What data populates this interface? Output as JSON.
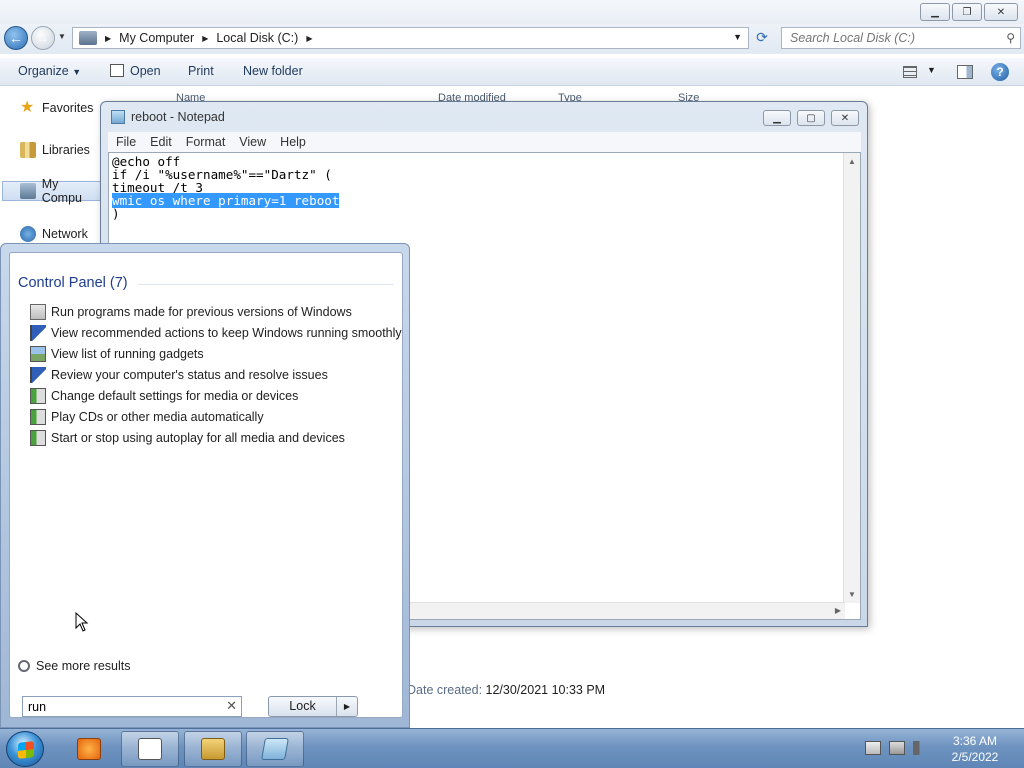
{
  "explorer": {
    "address": {
      "crumbs": [
        "My Computer",
        "Local Disk (C:)"
      ]
    },
    "search": {
      "placeholder": "Search Local Disk (C:)"
    },
    "toolbar": {
      "organize": "Organize",
      "open": "Open",
      "print": "Print",
      "new_folder": "New folder"
    },
    "nav": {
      "items": [
        "Favorites",
        "Libraries",
        "My Compu",
        "Network"
      ]
    },
    "columns": [
      "Name",
      "Date modified",
      "Type",
      "Size"
    ],
    "details": {
      "label": "Date created:",
      "value": "12/30/2021 10:33 PM"
    }
  },
  "notepad": {
    "title": "reboot - Notepad",
    "menu": [
      "File",
      "Edit",
      "Format",
      "View",
      "Help"
    ],
    "lines": [
      "@echo off",
      "if /i \"%username%\"==\"Dartz\" (",
      "timeout /t 3",
      "wmic os where primary=1 reboot",
      ")"
    ],
    "selected_line_index": 3
  },
  "startmenu": {
    "group_header": "Control Panel (7)",
    "results": [
      {
        "label": "Run programs made for previous versions of Windows",
        "icon": "compatibility-icon"
      },
      {
        "label": "View recommended actions to keep Windows running smoothly",
        "icon": "action-center-flag-icon"
      },
      {
        "label": "View list of running gadgets",
        "icon": "gadgets-icon"
      },
      {
        "label": "Review your computer's status and resolve issues",
        "icon": "action-center-flag-icon"
      },
      {
        "label": "Change default settings for media or devices",
        "icon": "autoplay-icon"
      },
      {
        "label": "Play CDs or other media automatically",
        "icon": "autoplay-icon"
      },
      {
        "label": "Start or stop using autoplay for all media and devices",
        "icon": "autoplay-icon"
      }
    ],
    "see_more": "See more results",
    "search_value": "run",
    "lock_label": "Lock"
  },
  "taskbar": {
    "clock": {
      "time": "3:36 AM",
      "date": "2/5/2022"
    },
    "buttons": [
      "windows-media-player",
      "solitaire",
      "windows-explorer",
      "notepad"
    ]
  },
  "colors": {
    "selection": "#3399ff",
    "header_text": "#1e3d8c",
    "taskbar": "#6e93c0"
  }
}
